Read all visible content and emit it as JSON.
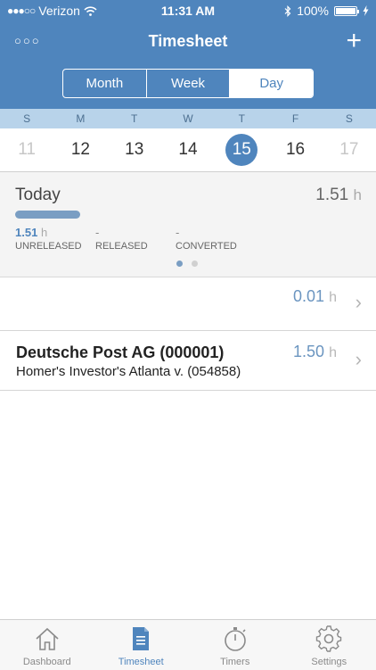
{
  "status_bar": {
    "signal": "●●●○○",
    "carrier": "Verizon",
    "time": "11:31 AM",
    "battery": "100%"
  },
  "nav": {
    "title": "Timesheet",
    "more_label": "○○○",
    "add_label": "+"
  },
  "segments": [
    {
      "label": "Month",
      "active": false
    },
    {
      "label": "Week",
      "active": false
    },
    {
      "label": "Day",
      "active": true
    }
  ],
  "weekdays": [
    "S",
    "M",
    "T",
    "W",
    "T",
    "F",
    "S"
  ],
  "dates": [
    {
      "label": "11",
      "muted": true
    },
    {
      "label": "12"
    },
    {
      "label": "13"
    },
    {
      "label": "14"
    },
    {
      "label": "15",
      "selected": true
    },
    {
      "label": "16"
    },
    {
      "label": "17",
      "muted": true
    }
  ],
  "summary": {
    "title": "Today",
    "total": "1.51",
    "unit": "h",
    "stats": [
      {
        "value": "1.51",
        "unit": "h",
        "label": "UNRELEASED"
      },
      {
        "value": "-",
        "label": "RELEASED"
      },
      {
        "value": "-",
        "label": "CONVERTED"
      }
    ]
  },
  "entries": [
    {
      "title": "",
      "subtitle": "",
      "hours": "0.01",
      "unit": "h"
    },
    {
      "title": "Deutsche Post AG (000001)",
      "subtitle": "Homer's Investor's Atlanta v. (054858)",
      "hours": "1.50",
      "unit": "h"
    }
  ],
  "chevron": "›",
  "tabs": [
    {
      "label": "Dashboard",
      "icon": "house-icon",
      "active": false
    },
    {
      "label": "Timesheet",
      "icon": "document-icon",
      "active": true
    },
    {
      "label": "Timers",
      "icon": "stopwatch-icon",
      "active": false
    },
    {
      "label": "Settings",
      "icon": "gear-icon",
      "active": false
    }
  ],
  "colors": {
    "accent": "#4f85bd",
    "weekday_strip": "#b8d3ea",
    "summary_bg": "#f4f4f4"
  }
}
